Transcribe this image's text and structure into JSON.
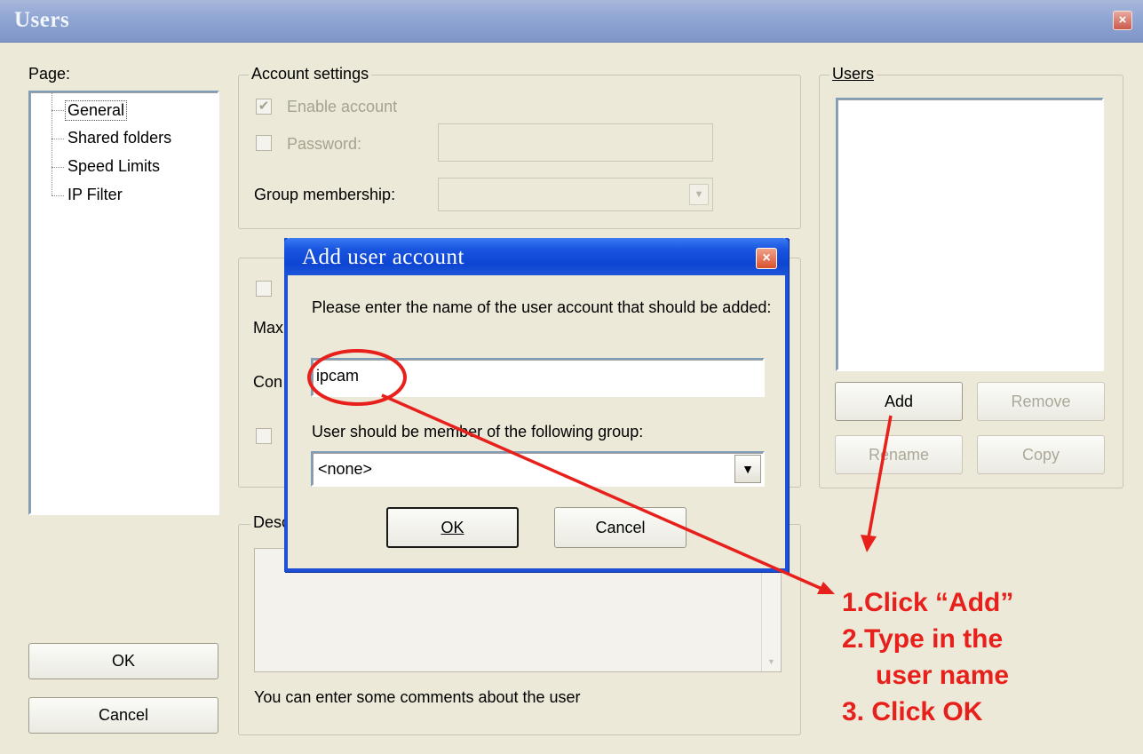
{
  "window": {
    "title": "Users",
    "close_glyph": "×"
  },
  "page_panel": {
    "label": "Page:",
    "items": [
      "General",
      "Shared folders",
      "Speed Limits",
      "IP Filter"
    ],
    "ok_label": "OK",
    "cancel_label": "Cancel"
  },
  "account_settings": {
    "legend": "Account settings",
    "enable_account": "Enable account",
    "password_label": "Password:",
    "group_membership_label": "Group membership:",
    "enable_checked": true,
    "password_checked": false
  },
  "partial_group": {
    "row_max": "Max",
    "row_con": "Con"
  },
  "description": {
    "legend": "Desc",
    "hint": "You can enter some comments about the user"
  },
  "users_panel": {
    "legend": "Users",
    "add_label": "Add",
    "remove_label": "Remove",
    "rename_label": "Rename",
    "copy_label": "Copy"
  },
  "dialog": {
    "title": "Add user account",
    "close_glyph": "×",
    "prompt": "Please enter the name of the user account that should be added:",
    "username_value": "ipcam",
    "group_prompt": "User should be member of the following group:",
    "group_value": "<none>",
    "ok_label": "OK",
    "cancel_label": "Cancel"
  },
  "annotation": {
    "steps": [
      "1.Click “Add”",
      "2.Type in the",
      "user name",
      "3. Click OK"
    ],
    "color": "#e8201c"
  },
  "icons": {
    "checkmark": "✔",
    "dropdown_arrow": "▼"
  }
}
